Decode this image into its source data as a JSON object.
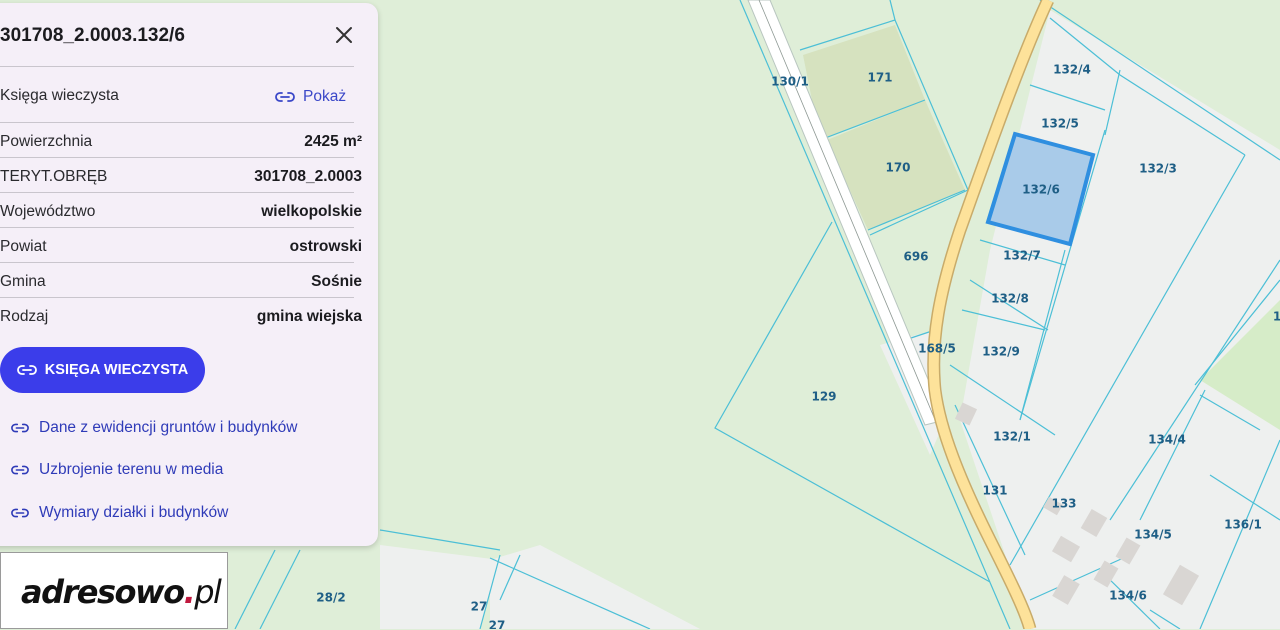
{
  "panel": {
    "title": "301708_2.0003.132/6",
    "close_icon": "close-icon",
    "kw_label": "Księga wieczysta",
    "kw_show": "Pokaż",
    "rows": [
      {
        "label": "Powierzchnia",
        "value": "2425 m²"
      },
      {
        "label": "TERYT.OBRĘB",
        "value": "301708_2.0003"
      },
      {
        "label": "Województwo",
        "value": "wielkopolskie"
      },
      {
        "label": "Powiat",
        "value": "ostrowski"
      },
      {
        "label": "Gmina",
        "value": "Sośnie"
      },
      {
        "label": "Rodzaj",
        "value": "gmina wiejska"
      }
    ],
    "primary_button": "KSIĘGA WIECZYSTA",
    "links": [
      "Dane z ewidencji gruntów i budynków",
      "Uzbrojenie terenu w media",
      "Wymiary działki i budynków"
    ],
    "accent_color": "#3b3dea"
  },
  "logo": {
    "text_main": "adresowo",
    "text_dot": ".",
    "text_tld": "pl"
  },
  "map": {
    "parcel_labels": [
      "130/1",
      "171",
      "170",
      "696",
      "129",
      "168/5",
      "132/4",
      "132/5",
      "132/6",
      "132/3",
      "132/7",
      "132/8",
      "132/9",
      "132/1",
      "131",
      "133",
      "134/4",
      "134/5",
      "134/6",
      "136/1",
      "28/2",
      "27",
      "27",
      "1"
    ],
    "selected_parcel": "132/6",
    "selected_color": "#2f8fe0",
    "parcel_line_color": "#4cbfd6"
  }
}
